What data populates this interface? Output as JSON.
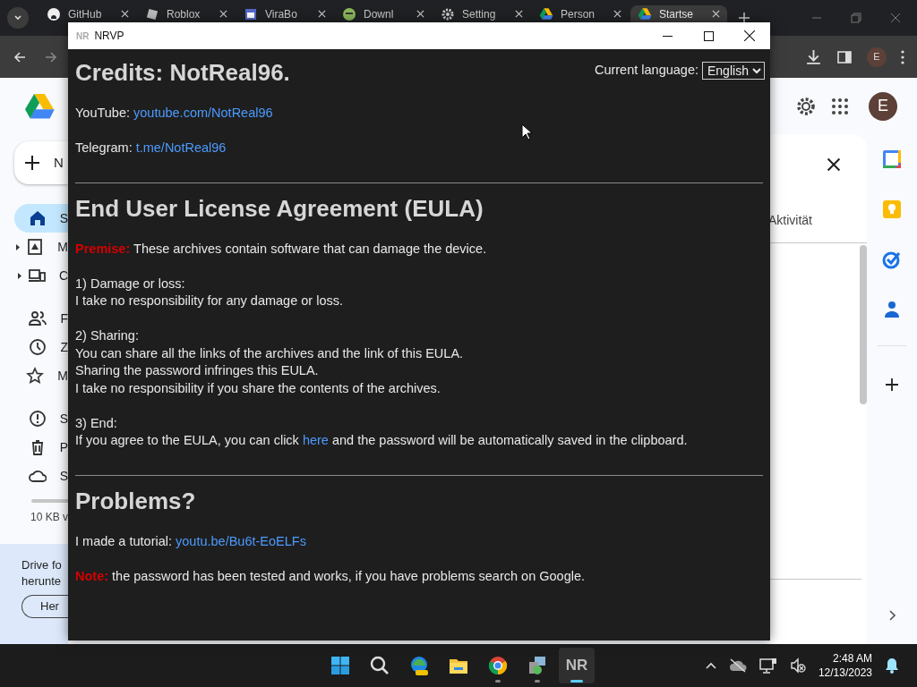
{
  "browser": {
    "tabs": [
      {
        "title": "GitHub",
        "selected": false
      },
      {
        "title": "Roblox",
        "selected": false
      },
      {
        "title": "ViraBo",
        "selected": false
      },
      {
        "title": "Downl",
        "selected": false
      },
      {
        "title": "Setting",
        "selected": false
      },
      {
        "title": "Person",
        "selected": false
      },
      {
        "title": "Startse",
        "selected": true
      }
    ],
    "profile_initial": "E"
  },
  "drive": {
    "new_button": "N",
    "nav_groups": [
      [
        {
          "label": "S",
          "selected": true,
          "expandable": false
        },
        {
          "label": "M",
          "selected": false,
          "expandable": true
        },
        {
          "label": "C",
          "selected": false,
          "expandable": true
        }
      ],
      [
        {
          "label": "F",
          "selected": false,
          "expandable": false
        },
        {
          "label": "Z",
          "selected": false,
          "expandable": false
        },
        {
          "label": "M",
          "selected": false,
          "expandable": false
        }
      ],
      [
        {
          "label": "S",
          "selected": false,
          "expandable": false
        },
        {
          "label": "P",
          "selected": false,
          "expandable": false
        },
        {
          "label": "S",
          "selected": false,
          "expandable": false
        }
      ]
    ],
    "storage_text": "10 KB v",
    "promo": {
      "lines": [
        "Drive fo",
        "herunte"
      ],
      "button": "Her"
    },
    "avatar": "E",
    "panel_tab": "Aktivität"
  },
  "dialog": {
    "app_icon": "NR",
    "title": "NRVP",
    "heading": "Credits: NotReal96.",
    "language": {
      "label": "Current language:",
      "value": "English"
    },
    "contacts": [
      {
        "label": "YouTube:",
        "link": "youtube.com/NotReal96"
      },
      {
        "label": "Telegram:",
        "link": "t.me/NotReal96"
      }
    ],
    "eula": {
      "heading": "End User License Agreement (EULA)",
      "premise": {
        "label": "Premise:",
        "text": "These archives contain software that can damage the device."
      },
      "sections": [
        {
          "lines": [
            "1) Damage or loss:",
            "I take no responsibility for any damage or loss."
          ]
        },
        {
          "lines": [
            "2) Sharing:",
            "You can share all the links of the archives and the link of this EULA.",
            "Sharing the password infringes this EULA.",
            "I take no responsibility if you share the contents of the archives."
          ]
        },
        {
          "lines": [
            "3) End:"
          ],
          "link_line": {
            "before": "If you agree to the EULA, you can click ",
            "link": "here",
            "after": " and the password will be automatically saved in the clipboard."
          }
        }
      ]
    },
    "problems": {
      "heading": "Problems?",
      "tutorial": {
        "label": "I made a tutorial:",
        "link": "youtu.be/Bu6t-EoELFs"
      },
      "note": {
        "label": "Note:",
        "text": "the password has been tested and works, if you have problems search on Google."
      }
    }
  },
  "taskbar": {
    "apps": [
      {
        "selected": false,
        "running": false
      },
      {
        "selected": false,
        "running": false
      },
      {
        "selected": false,
        "running": false
      },
      {
        "selected": false,
        "running": false
      },
      {
        "selected": false,
        "running": true
      },
      {
        "selected": false,
        "running": true
      },
      {
        "selected": true,
        "running": true,
        "label": "NR"
      }
    ],
    "time": "2:48 AM",
    "date": "12/13/2023"
  }
}
